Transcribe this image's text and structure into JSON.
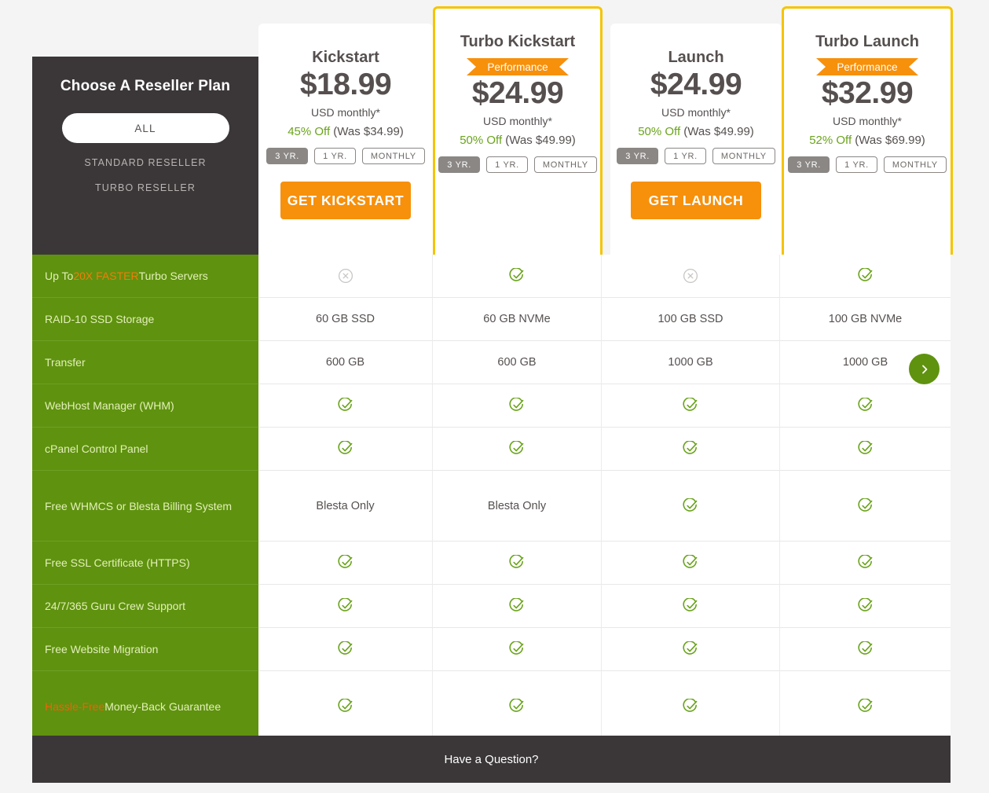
{
  "chooser": {
    "title": "Choose A Reseller Plan",
    "selected_filter": "ALL",
    "options": [
      "STANDARD RESELLER",
      "TURBO RESELLER"
    ]
  },
  "colors": {
    "accent_orange": "#f7900b",
    "feature_green": "#5f920f",
    "highlight_yellow": "#f5c400",
    "dark": "#3b3738",
    "promo_green": "#6aa31b"
  },
  "plans": [
    {
      "name": "Kickstart",
      "badge": null,
      "price": "$18.99",
      "period": "USD monthly*",
      "discount": "45% Off",
      "was": "(Was $34.99)",
      "terms": [
        "3 YR.",
        "1 YR.",
        "MONTHLY"
      ],
      "active_term": "3 YR.",
      "cta": "GET KICKSTART",
      "featured": false
    },
    {
      "name": "Turbo Kickstart",
      "badge": "Performance",
      "price": "$24.99",
      "period": "USD monthly*",
      "discount": "50% Off",
      "was": "(Was $49.99)",
      "terms": [
        "3 YR.",
        "1 YR.",
        "MONTHLY"
      ],
      "active_term": "3 YR.",
      "cta": null,
      "featured": true
    },
    {
      "name": "Launch",
      "badge": null,
      "price": "$24.99",
      "period": "USD monthly*",
      "discount": "50% Off",
      "was": "(Was $49.99)",
      "terms": [
        "3 YR.",
        "1 YR.",
        "MONTHLY"
      ],
      "active_term": "3 YR.",
      "cta": "GET LAUNCH",
      "featured": false
    },
    {
      "name": "Turbo Launch",
      "badge": "Performance",
      "price": "$32.99",
      "period": "USD monthly*",
      "discount": "52% Off",
      "was": "(Was $69.99)",
      "terms": [
        "3 YR.",
        "1 YR.",
        "MONTHLY"
      ],
      "active_term": "3 YR.",
      "cta": null,
      "featured": true
    }
  ],
  "features": [
    {
      "label_parts": [
        {
          "text": "Up To ",
          "style": "normal"
        },
        {
          "text": "20X FASTER",
          "style": "orange"
        },
        {
          "text": " Turbo Servers",
          "style": "normal"
        }
      ],
      "label": "Up To 20X FASTER Turbo Servers",
      "values": [
        "cross",
        "check",
        "cross",
        "check"
      ]
    },
    {
      "label": "RAID-10 SSD Storage",
      "values": [
        "60 GB SSD",
        "60 GB NVMe",
        "100 GB SSD",
        "100 GB NVMe"
      ]
    },
    {
      "label": "Transfer",
      "values": [
        "600 GB",
        "600 GB",
        "1000 GB",
        "1000 GB"
      ]
    },
    {
      "label": "WebHost Manager (WHM)",
      "values": [
        "check",
        "check",
        "check",
        "check"
      ]
    },
    {
      "label": "cPanel Control Panel",
      "values": [
        "check",
        "check",
        "check",
        "check"
      ]
    },
    {
      "label": "Free WHMCS or Blesta Billing System",
      "values": [
        "Blesta Only",
        "Blesta Only",
        "check",
        "check"
      ]
    },
    {
      "label": "Free SSL Certificate (HTTPS)",
      "values": [
        "check",
        "check",
        "check",
        "check"
      ]
    },
    {
      "label": "24/7/365 Guru Crew Support",
      "values": [
        "check",
        "check",
        "check",
        "check"
      ]
    },
    {
      "label": "Free Website Migration",
      "values": [
        "check",
        "check",
        "check",
        "check"
      ]
    },
    {
      "label_parts": [
        {
          "text": "Hassle-Free",
          "style": "orange2"
        },
        {
          "text": " Money-Back Guarantee",
          "style": "normal"
        }
      ],
      "label": "Hassle-Free Money-Back Guarantee",
      "values": [
        "check",
        "check",
        "check",
        "check"
      ]
    }
  ],
  "next_arrow_icon": "chevron-right-icon",
  "footer": {
    "question": "Have a Question?"
  }
}
